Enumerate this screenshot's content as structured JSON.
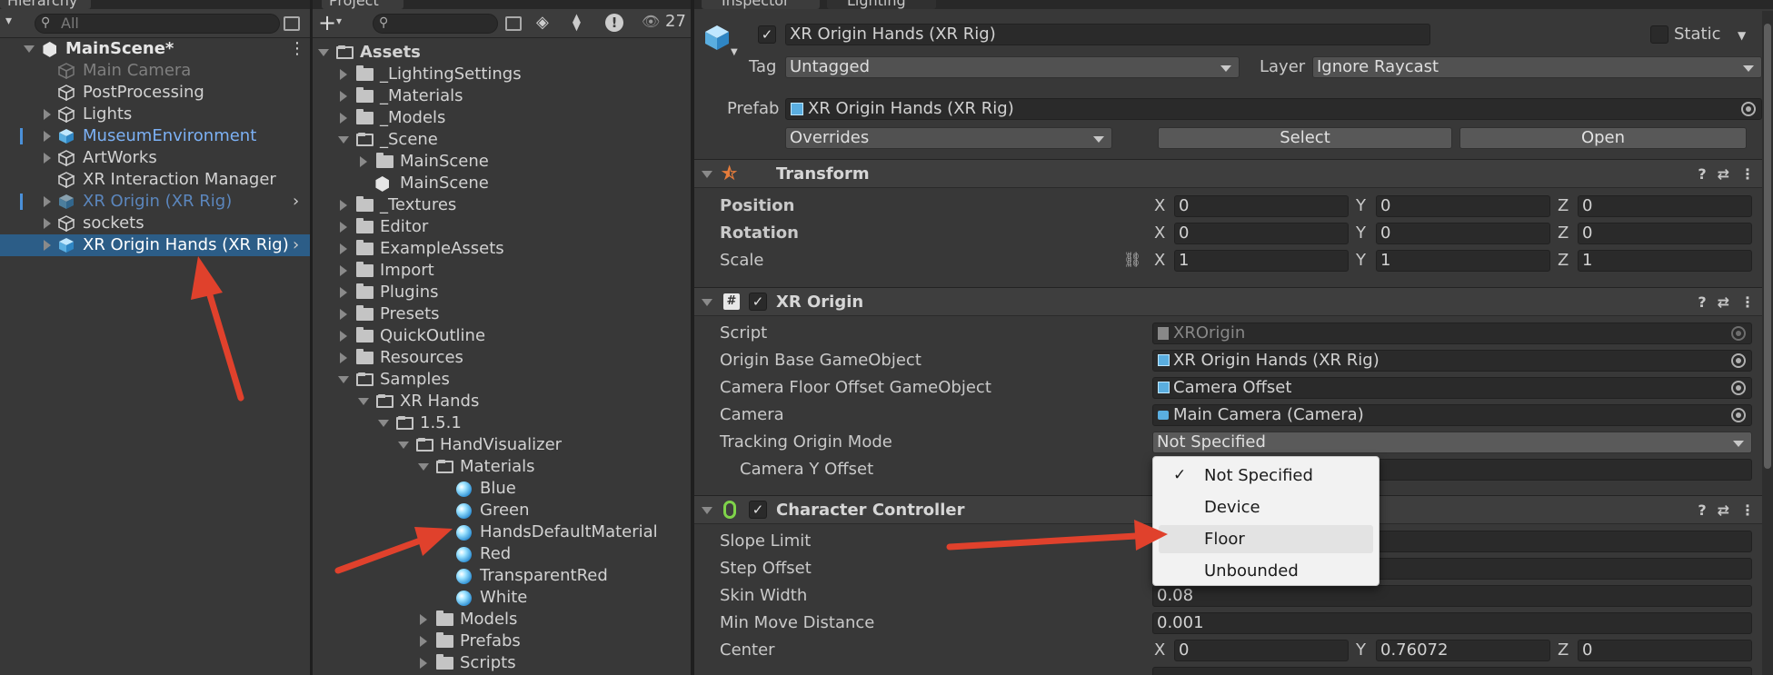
{
  "hierarchy": {
    "tab": "Hierarchy",
    "search_placeholder": "All",
    "scene": "MainScene*",
    "items": [
      {
        "label": "Main Camera",
        "style": "grey",
        "icon": "cube-icon",
        "indent": 1
      },
      {
        "label": "PostProcessing",
        "style": "normal",
        "icon": "cube-icon",
        "indent": 1
      },
      {
        "label": "Lights",
        "style": "normal",
        "icon": "cube-icon",
        "indent": 1,
        "arrow": true
      },
      {
        "label": "MuseumEnvironment",
        "style": "blue",
        "icon": "prefab-icon",
        "indent": 1,
        "arrow": true
      },
      {
        "label": "ArtWorks",
        "style": "normal",
        "icon": "cube-icon",
        "indent": 1,
        "arrow": true
      },
      {
        "label": "XR Interaction Manager",
        "style": "normal",
        "icon": "cube-icon",
        "indent": 1
      },
      {
        "label": "XR Origin (XR Rig)",
        "style": "blue-dim",
        "icon": "prefab-icon",
        "indent": 1,
        "arrow": true
      },
      {
        "label": "sockets",
        "style": "normal",
        "icon": "cube-icon",
        "indent": 1,
        "arrow": true
      },
      {
        "label": "XR Origin Hands (XR Rig)",
        "style": "selected",
        "icon": "prefab-icon",
        "indent": 1,
        "arrow": true
      }
    ]
  },
  "project": {
    "tab": "Project",
    "count": "27",
    "items": [
      {
        "label": "Assets",
        "type": "folder-open",
        "depth": 0,
        "expanded": true,
        "bold": true
      },
      {
        "label": "_LightingSettings",
        "type": "folder",
        "depth": 1
      },
      {
        "label": "_Materials",
        "type": "folder",
        "depth": 1
      },
      {
        "label": "_Models",
        "type": "folder",
        "depth": 1
      },
      {
        "label": "_Scene",
        "type": "folder-open",
        "depth": 1,
        "expanded": true
      },
      {
        "label": "MainScene",
        "type": "folder",
        "depth": 2
      },
      {
        "label": "MainScene",
        "type": "scene",
        "depth": 2,
        "noarrow": true
      },
      {
        "label": "_Textures",
        "type": "folder",
        "depth": 1
      },
      {
        "label": "Editor",
        "type": "folder",
        "depth": 1
      },
      {
        "label": "ExampleAssets",
        "type": "folder",
        "depth": 1
      },
      {
        "label": "Import",
        "type": "folder",
        "depth": 1
      },
      {
        "label": "Plugins",
        "type": "folder",
        "depth": 1
      },
      {
        "label": "Presets",
        "type": "folder",
        "depth": 1
      },
      {
        "label": "QuickOutline",
        "type": "folder",
        "depth": 1
      },
      {
        "label": "Resources",
        "type": "folder",
        "depth": 1
      },
      {
        "label": "Samples",
        "type": "folder-open",
        "depth": 1,
        "expanded": true
      },
      {
        "label": "XR Hands",
        "type": "folder-open",
        "depth": 2,
        "expanded": true
      },
      {
        "label": "1.5.1",
        "type": "folder-open",
        "depth": 3,
        "expanded": true
      },
      {
        "label": "HandVisualizer",
        "type": "folder-open",
        "depth": 4,
        "expanded": true
      },
      {
        "label": "Materials",
        "type": "folder-open",
        "depth": 5,
        "expanded": true
      },
      {
        "label": "Blue",
        "type": "material",
        "depth": 6,
        "noarrow": true
      },
      {
        "label": "Green",
        "type": "material",
        "depth": 6,
        "noarrow": true
      },
      {
        "label": "HandsDefaultMaterial",
        "type": "material",
        "depth": 6,
        "noarrow": true
      },
      {
        "label": "Red",
        "type": "material",
        "depth": 6,
        "noarrow": true
      },
      {
        "label": "TransparentRed",
        "type": "material",
        "depth": 6,
        "noarrow": true
      },
      {
        "label": "White",
        "type": "material",
        "depth": 6,
        "noarrow": true
      },
      {
        "label": "Models",
        "type": "folder",
        "depth": 5
      },
      {
        "label": "Prefabs",
        "type": "folder",
        "depth": 5
      },
      {
        "label": "Scripts",
        "type": "folder",
        "depth": 5
      }
    ]
  },
  "inspector": {
    "tab": "Inspector",
    "tab2": "Lighting",
    "object_name": "XR Origin Hands (XR Rig)",
    "static_label": "Static",
    "tag_label": "Tag",
    "tag_value": "Untagged",
    "layer_label": "Layer",
    "layer_value": "Ignore Raycast",
    "prefab_label": "Prefab",
    "prefab_value": "XR Origin Hands (XR Rig)",
    "overrides": "Overrides",
    "select": "Select",
    "open": "Open",
    "transform": {
      "title": "Transform",
      "position": "Position",
      "rotation": "Rotation",
      "scale": "Scale",
      "pos": [
        "0",
        "0",
        "0"
      ],
      "rot": [
        "0",
        "0",
        "0"
      ],
      "scl": [
        "1",
        "1",
        "1"
      ]
    },
    "axis": {
      "x": "X",
      "y": "Y",
      "z": "Z"
    },
    "xr_origin": {
      "title": "XR Origin",
      "script_label": "Script",
      "script_value": "XROrigin",
      "origin_base_label": "Origin Base GameObject",
      "origin_base_value": "XR Origin Hands (XR Rig)",
      "camera_floor_label": "Camera Floor Offset GameObject",
      "camera_floor_value": "Camera Offset",
      "camera_label": "Camera",
      "camera_value": "Main Camera (Camera)",
      "tracking_label": "Tracking Origin Mode",
      "tracking_value": "Not Specified",
      "camera_y_label": "Camera Y Offset"
    },
    "character_controller": {
      "title": "Character Controller",
      "slope_label": "Slope Limit",
      "step_label": "Step Offset",
      "skin_label": "Skin Width",
      "skin_value": "0.08",
      "min_move_label": "Min Move Distance",
      "min_move_value": "0.001",
      "center_label": "Center",
      "center": [
        "0",
        "0.76072",
        "0"
      ]
    }
  },
  "dropdown": {
    "options": [
      "Not Specified",
      "Device",
      "Floor",
      "Unbounded"
    ],
    "checked": "Not Specified",
    "highlighted": "Floor",
    "check_glyph": "✓"
  },
  "colors": {
    "selection": "#2c5d87",
    "prefab_blue": "#7cb1f5",
    "annotation_arrow": "#e0412c"
  }
}
